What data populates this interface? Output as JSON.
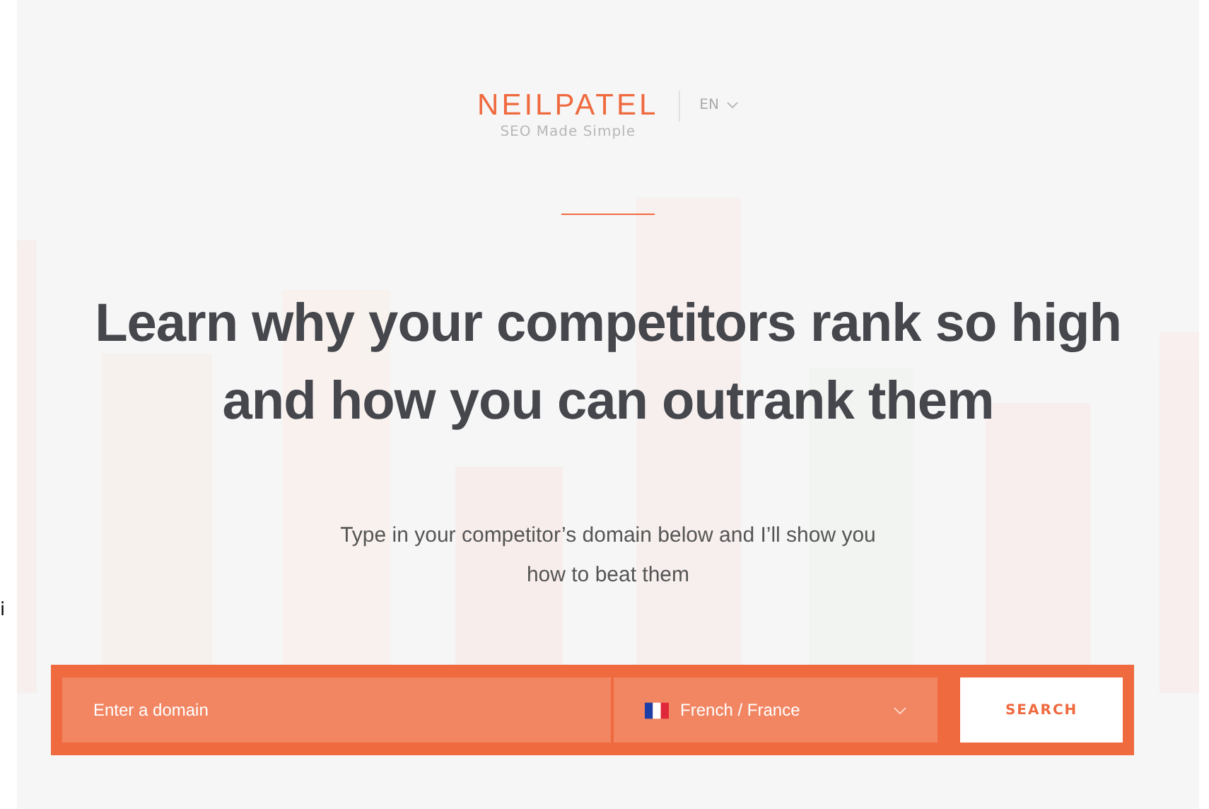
{
  "header": {
    "logo": "NEILPATEL",
    "tagline": "SEO Made Simple",
    "language": "EN"
  },
  "hero": {
    "title": "Learn why your competitors rank so high and how you can outrank them",
    "subtitle": "Type in your competitor’s domain below and I’ll show you how to beat them"
  },
  "search": {
    "placeholder": "Enter a domain",
    "language_select": "French / France",
    "button": "SEARCH"
  },
  "edge_text": "i"
}
